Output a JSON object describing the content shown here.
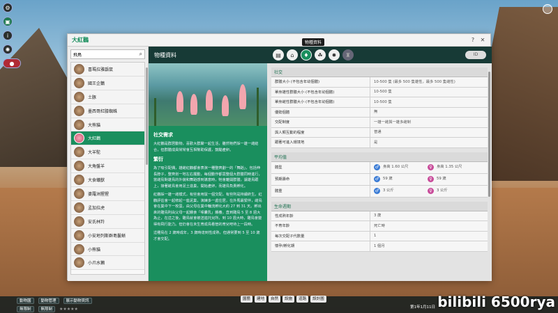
{
  "window": {
    "title": "大紅鸛",
    "help": "?",
    "close": "✕",
    "tooltip": "物種資料"
  },
  "search": {
    "value": "飛鳥",
    "placeholder": ""
  },
  "header": {
    "title": "物種資料",
    "cloud_label": "ID"
  },
  "animals": [
    "喜瑪拉雅鼯鼠",
    "國王企鵝",
    "土豚",
    "墨西哥紅膝蜘蛛",
    "大熊貓",
    "大紅鸛",
    "大羊駝",
    "大角盤羊",
    "大食蟻獸",
    "婆羅洲猩猩",
    "孟加拉虎",
    "安氏林羚",
    "小安地列斯群島鬣蜥",
    "小熊貓",
    "小爪水獺"
  ],
  "selected_index": 5,
  "info": {
    "social_title": "社交需求",
    "social_text": "大紅鸛是群居動物，喜歡大群聚一起生活，雖然牠們採一雄一雌結合，但群體成員常常會互相幫助保護，鼓勵產卵。",
    "breeding_title": "繁衍",
    "breeding_text1": "為了吸引配偶，雄雌紅鸛都會表演一種整齊劃一的「舞蹈」，包括伸長脖子，整齊划一地左右擺動，每個動作都需整個大群體同時進行，當雌鳥對雄鳥的外貌和舞蹈感到滿意時，牠會離開群體，讓雄鳥跟上，接著雌鳥會用泥土造巢，開始產卵，而雄鳥負責孵化。",
    "breeding_text2": "紅鸛採一雄一雌模式，有些會用鼠一個交配，有些則是持續終生。紅鸛評估會一起修起一座泥巢，演練多一處住居，在外馬最緊伴，雌鳥會在巢中下一枚蛋，由父母在巢中輪流孵化大約 27 到 31 天。孵出來的雛鳥則由父母一起餵食「嗉囊乳」餵養，直到雛鳥 5 至 8 週大為止，在這之後，雛鳥就會被送進托兒所，到 10 週大時，雛鳥會變得有飛行能力。但仍會在未生育成鳥看管的育兒吧待上一段時。",
    "breeding_text3": "這種鳥在 2 歲時成年，3 歲時達到性成熟，但通常要到 5 至 10 歲才會交配。"
  },
  "social": {
    "title": "社交",
    "rows": [
      {
        "label": "群體大小 (不包含年幼個體)",
        "value": "10-500 隻 (最多 500 隻雄性，最多 500 隻雌性)"
      },
      {
        "label": "單身雄性群體大小 (不包含年幼個體)",
        "value": "10-500 隻"
      },
      {
        "label": "單身雌性群體大小 (不包含年幼個體)",
        "value": "10-500 隻"
      },
      {
        "label": "優勢個體",
        "value": "無"
      },
      {
        "label": "交配制度",
        "value": "一雄一雌與一雄多雌制"
      },
      {
        "label": "與人類互動的程度",
        "value": "普通"
      },
      {
        "label": "跟著可進入環境地",
        "value": "是"
      }
    ]
  },
  "average": {
    "title": "平均值",
    "rows": [
      {
        "label": "體型",
        "male": "身高 1.60 公尺",
        "female": "身高 1.35 公尺"
      },
      {
        "label": "預期壽命",
        "male": "59 歲",
        "female": "59 歲"
      },
      {
        "label": "體重",
        "male": "3 公斤",
        "female": "3 公斤"
      }
    ]
  },
  "life": {
    "title": "生命週期",
    "rows": [
      {
        "label": "性成熟年齡",
        "value": "3 歲"
      },
      {
        "label": "不育年齡",
        "value": "死亡時"
      },
      {
        "label": "每次交配子代數量",
        "value": "1"
      },
      {
        "label": "懷孕/孵化期",
        "value": "1 個月"
      }
    ]
  },
  "bottombar": {
    "chip1": "動物園",
    "chip2": "動物管理",
    "chip3": "展示動物資訊",
    "mode1": "無限制",
    "mode2": "無限制",
    "center": [
      "園藝",
      "建地",
      "自然",
      "設施",
      "道路",
      "設計圖"
    ],
    "date": "第1年1月11日"
  },
  "watermark": "bilibili 6500rya",
  "colors": {
    "accent": "#1a8f5e",
    "header": "#173a36",
    "male": "#3a7bd5",
    "female": "#c84c9a"
  }
}
